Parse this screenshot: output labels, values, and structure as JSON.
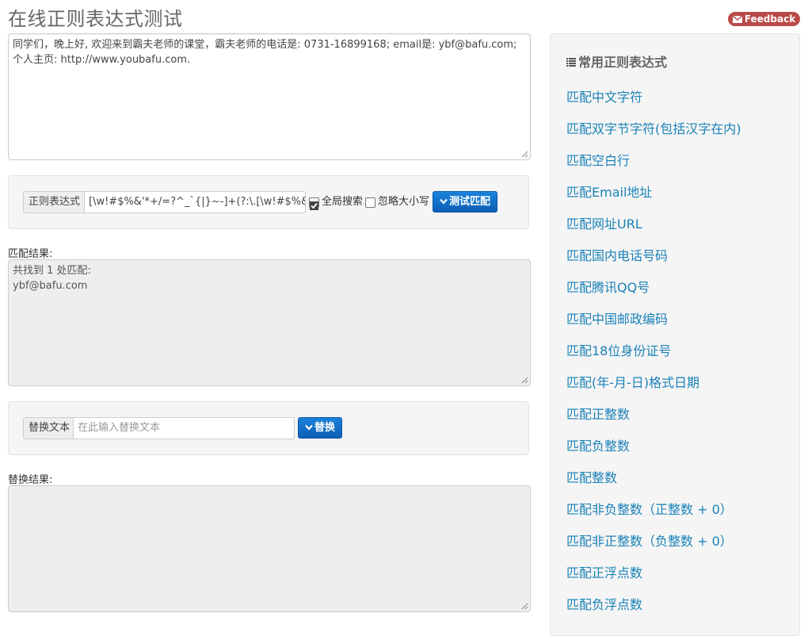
{
  "page": {
    "title": "在线正则表达式测试",
    "feedback_label": "Feedback"
  },
  "source_text": "同学们，晚上好, 欢迎来到霸夫老师的课堂，霸夫老师的电话是: 0731-16899168; email是: ybf@bafu.com; 个人主页: http://www.youbafu.com.",
  "regex_panel": {
    "label": "正则表达式",
    "value": "[\\w!#$%&'*+/=?^_`{|}~-]+(?:\\.[\\w!#$%&'*+/=?^_`{|}~-]+)*@(?:[\\w](?:[\\w-]*[\\w])?\\.)+[\\w](?:[\\w-]*[\\w])?",
    "global_label": "全局搜索",
    "global_checked": true,
    "ignore_case_label": "忽略大小写",
    "ignore_case_checked": false,
    "test_button": "测试匹配"
  },
  "match_result": {
    "label": "匹配结果:",
    "summary": "共找到 1 处匹配:",
    "match": "ybf@bafu.com"
  },
  "replace_panel": {
    "label": "替换文本",
    "placeholder": "在此输入替换文本",
    "button": "替换"
  },
  "replace_result": {
    "label": "替换结果:",
    "value": ""
  },
  "sidebar": {
    "header": "常用正则表达式",
    "items": [
      "匹配中文字符",
      "匹配双字节字符(包括汉字在内)",
      "匹配空白行",
      "匹配Email地址",
      "匹配网址URL",
      "匹配国内电话号码",
      "匹配腾讯QQ号",
      "匹配中国邮政编码",
      "匹配18位身份证号",
      "匹配(年-月-日)格式日期",
      "匹配正整数",
      "匹配负整数",
      "匹配整数",
      "匹配非负整数（正整数 + 0）",
      "匹配非正整数（负整数 + 0）",
      "匹配正浮点数",
      "匹配负浮点数"
    ]
  },
  "colors": {
    "link": "#1a82b8",
    "button_blue": "#0d6cc7",
    "feedback_red": "#b94a48",
    "panel_bg": "#f5f5f5"
  },
  "icons": [
    "mail-icon",
    "chevron-down-icon",
    "list-icon",
    "resize-grip-icon"
  ]
}
